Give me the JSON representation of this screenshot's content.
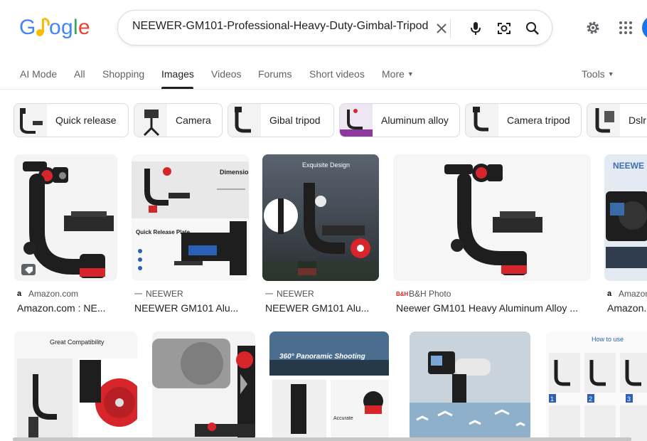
{
  "header": {
    "logo_text": "Google",
    "search_value": "NEEWER-GM101-Professional-Heavy-Duty-Gimbal-Tripod",
    "icons": [
      "close-icon",
      "mic-icon",
      "lens-icon",
      "search-icon",
      "gear-icon",
      "apps-grid-icon"
    ]
  },
  "tabs": {
    "items": [
      {
        "label": "AI Mode"
      },
      {
        "label": "All"
      },
      {
        "label": "Shopping"
      },
      {
        "label": "Images"
      },
      {
        "label": "Videos"
      },
      {
        "label": "Forums"
      },
      {
        "label": "Short videos"
      },
      {
        "label": "More"
      }
    ],
    "active": "Images",
    "tools_label": "Tools"
  },
  "chips": [
    {
      "label": "Quick release"
    },
    {
      "label": "Camera"
    },
    {
      "label": "Gibal tripod"
    },
    {
      "label": "Aluminum alloy"
    },
    {
      "label": "Camera tripod"
    },
    {
      "label": "Dslr"
    }
  ],
  "results": [
    {
      "source": "Amazon.com",
      "source_icon": "a",
      "title": "Amazon.com : NE..."
    },
    {
      "source": "NEEWER",
      "source_icon": "—",
      "title": "NEEWER GM101 Alu...",
      "img_text": [
        "Dimension",
        "Quick Release Plate"
      ]
    },
    {
      "source": "NEEWER",
      "source_icon": "—",
      "title": "NEEWER GM101 Alu...",
      "img_text": [
        "Exquisite Design"
      ]
    },
    {
      "source": "B&H Photo",
      "source_icon": "B&H",
      "title": "Neewer GM101 Heavy Aluminum Alloy ..."
    },
    {
      "source": "Amazon",
      "source_icon": "a",
      "title": "Amazon.",
      "img_text": [
        "NEEWE"
      ]
    }
  ],
  "row2": [
    {
      "img_text": [
        "Great Compatibility"
      ]
    },
    {
      "img_text": []
    },
    {
      "img_text": [
        "360° Panoramic Shooting",
        "Accurate"
      ]
    },
    {
      "img_text": []
    },
    {
      "img_text": [
        "How to use",
        "1",
        "2",
        "3"
      ]
    }
  ],
  "colors": {
    "accent_red": "#d6262b",
    "dark": "#1e1e1e",
    "blue": "#1a73e8"
  }
}
